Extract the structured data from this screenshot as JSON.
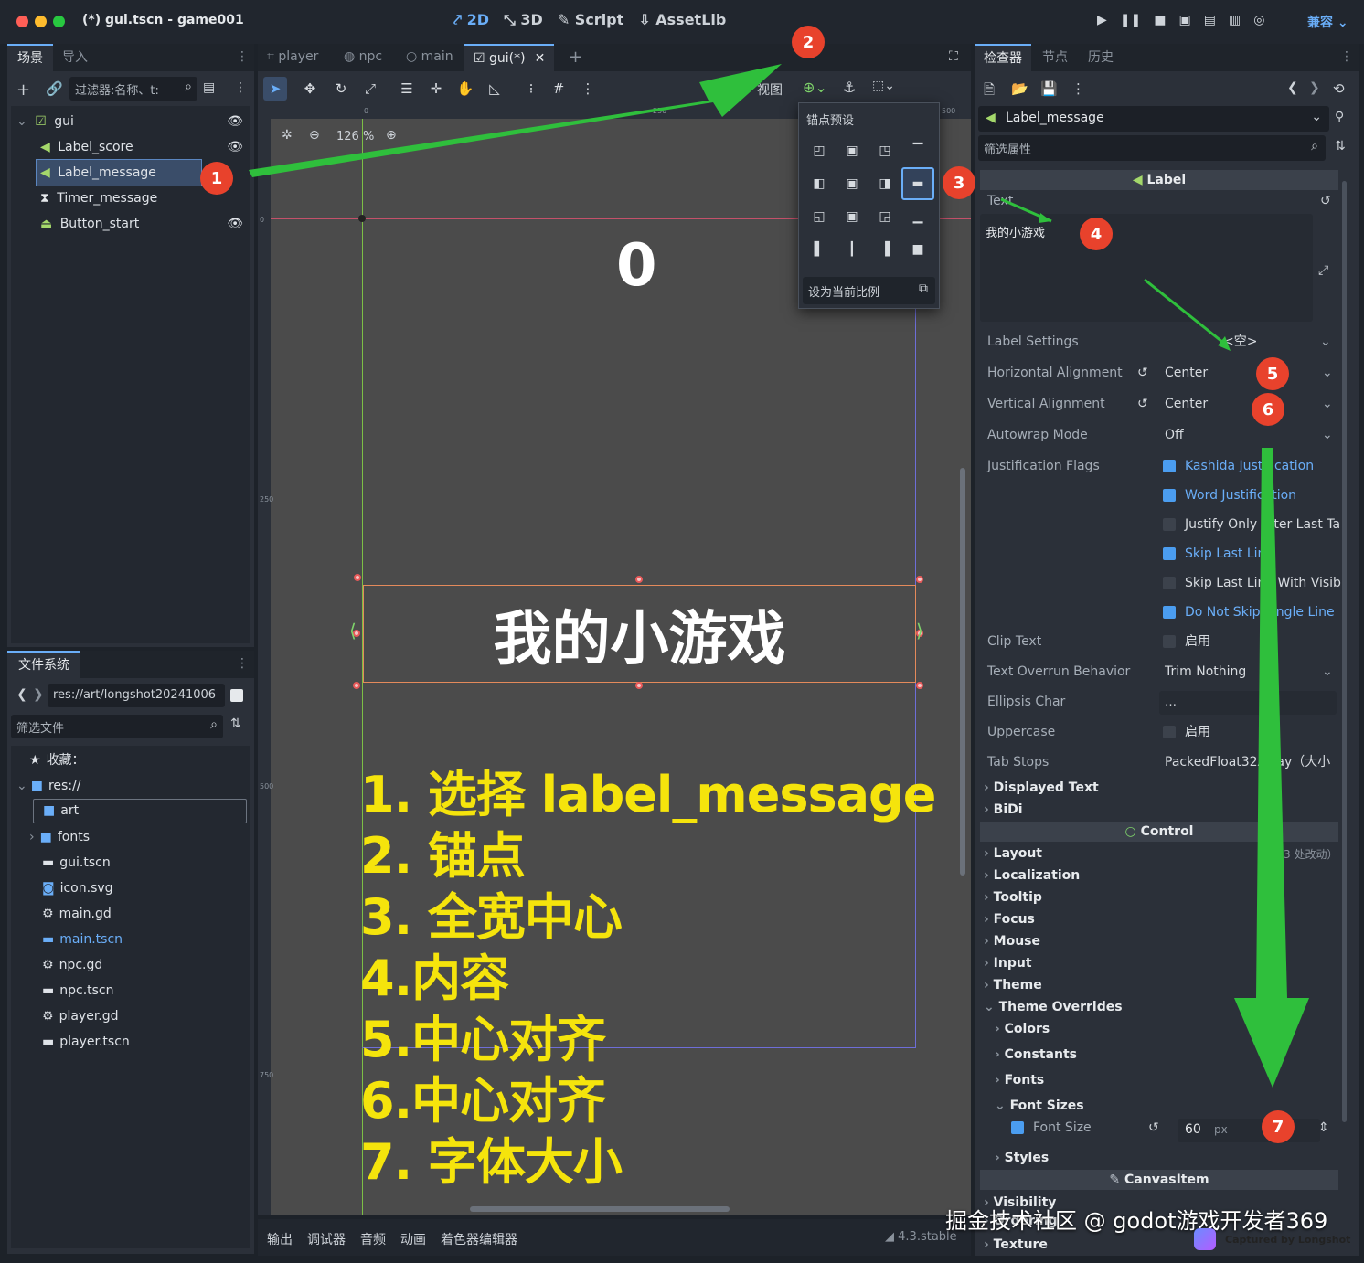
{
  "window": {
    "title": "(*) gui.tscn - game001"
  },
  "top_modes": [
    {
      "icon": "2d-icon",
      "label": "2D"
    },
    {
      "icon": "3d-icon",
      "label": "3D"
    },
    {
      "icon": "script-icon",
      "label": "Script"
    },
    {
      "icon": "assetlib-icon",
      "label": "AssetLib"
    }
  ],
  "compat_label": "兼容",
  "scene_dock": {
    "tabs": [
      "场景",
      "导入"
    ],
    "filter_placeholder": "过滤器:名称、t:",
    "nodes": [
      {
        "label": "gui",
        "icon": "control-icon"
      },
      {
        "label": "Label_score",
        "icon": "label-icon"
      },
      {
        "label": "Label_message",
        "icon": "label-icon"
      },
      {
        "label": "Timer_message",
        "icon": "timer-icon"
      },
      {
        "label": "Button_start",
        "icon": "button-icon"
      }
    ]
  },
  "fs_dock": {
    "tab": "文件系统",
    "path": "res://art/longshot20241006",
    "filter_placeholder": "筛选文件",
    "favorites": "收藏：",
    "root": "res://",
    "items": [
      {
        "label": "art",
        "type": "folder"
      },
      {
        "label": "fonts",
        "type": "folder"
      },
      {
        "label": "gui.tscn",
        "type": "scene"
      },
      {
        "label": "icon.svg",
        "type": "image"
      },
      {
        "label": "main.gd",
        "type": "script"
      },
      {
        "label": "main.tscn",
        "type": "scene"
      },
      {
        "label": "npc.gd",
        "type": "script"
      },
      {
        "label": "npc.tscn",
        "type": "scene"
      },
      {
        "label": "player.gd",
        "type": "script"
      },
      {
        "label": "player.tscn",
        "type": "scene"
      }
    ]
  },
  "editor_tabs": [
    {
      "label": "player"
    },
    {
      "label": "npc"
    },
    {
      "label": "main"
    },
    {
      "label": "gui(*)"
    }
  ],
  "toolbar": {
    "view_label": "视图",
    "zoom": "126 %"
  },
  "ruler": {
    "h_ticks": [
      "0",
      "250",
      "500"
    ],
    "v_ticks": [
      "0",
      "250",
      "500",
      "750"
    ]
  },
  "anchor_popup": {
    "title": "锚点预设",
    "ratio_label": "设为当前比例"
  },
  "canvas": {
    "score": "0",
    "message": "我的小游戏"
  },
  "instructions": [
    "1. 选择 label_message",
    "2. 锚点",
    "3. 全宽中心",
    "4.内容",
    "5.中心对齐",
    "6.中心对齐",
    "7. 字体大小"
  ],
  "bottom_tabs": [
    "输出",
    "调试器",
    "音频",
    "动画",
    "着色器编辑器"
  ],
  "version": "4.3.stable",
  "inspector": {
    "tabs": [
      "检查器",
      "节点",
      "历史"
    ],
    "node_name": "Label_message",
    "filter_placeholder": "筛选属性",
    "section_label": "Label",
    "text_label": "Text",
    "text_value": "我的小游戏",
    "label_settings": {
      "label": "Label Settings",
      "value": "<空>"
    },
    "h_align": {
      "label": "Horizontal Alignment",
      "value": "Center"
    },
    "v_align": {
      "label": "Vertical Alignment",
      "value": "Center"
    },
    "autowrap": {
      "label": "Autowrap Mode",
      "value": "Off"
    },
    "justification": {
      "label": "Justification Flags",
      "flags": [
        {
          "label": "Kashida Justification",
          "checked": true
        },
        {
          "label": "Word Justification",
          "checked": true
        },
        {
          "label": "Justify Only After Last Ta",
          "checked": false
        },
        {
          "label": "Skip Last Line",
          "checked": true
        },
        {
          "label": "Skip Last Line With Visibl",
          "checked": false
        },
        {
          "label": "Do Not Skip Single Line",
          "checked": true
        }
      ]
    },
    "clip_text": {
      "label": "Clip Text",
      "value": "启用"
    },
    "overrun": {
      "label": "Text Overrun Behavior",
      "value": "Trim Nothing"
    },
    "ellipsis": {
      "label": "Ellipsis Char",
      "value": "…"
    },
    "uppercase": {
      "label": "Uppercase",
      "value": "启用"
    },
    "tab_stops": {
      "label": "Tab Stops",
      "value": "PackedFloat32Array（大小"
    },
    "groups1": [
      "Displayed Text",
      "BiDi"
    ],
    "control_label": "Control",
    "layout_note": "（3 处改动）",
    "groups2": [
      "Layout",
      "Localization",
      "Tooltip",
      "Focus",
      "Mouse",
      "Input",
      "Theme",
      "Theme Overrides"
    ],
    "overrides": [
      "Colors",
      "Constants",
      "Fonts",
      "Font Sizes"
    ],
    "font_size": {
      "label": "Font Size",
      "value": "60",
      "unit": "px"
    },
    "styles": "Styles",
    "canvasitem_label": "CanvasItem",
    "groups3": [
      "Visibility",
      "Ordering",
      "Texture"
    ]
  },
  "annotations": {
    "badges": [
      "1",
      "2",
      "3",
      "4",
      "5",
      "6",
      "7"
    ]
  },
  "watermark": {
    "text": "掘金技术社区 @ godot游戏开发者369",
    "capture": "Captured by Longshot"
  }
}
